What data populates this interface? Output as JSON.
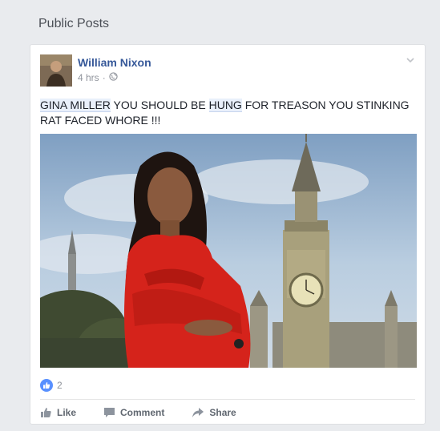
{
  "section": {
    "title": "Public Posts"
  },
  "post": {
    "author": "William Nixon",
    "time": "4 hrs",
    "separator": "·",
    "text_parts": {
      "p1": "GINA MILLER",
      "p2": " YOU SHOULD BE ",
      "p3": "HUNG",
      "p4": " FOR TREASON YOU STINKING RAT FACED WHORE !!!"
    },
    "like_count": "2"
  },
  "actions": {
    "like_label": "Like",
    "comment_label": "Comment",
    "share_label": "Share"
  },
  "icons": {
    "privacy": "globe-icon",
    "menu": "chevron-down-icon",
    "like": "thumbs-up-icon",
    "comment": "speech-bubble-icon",
    "share": "share-arrow-icon"
  },
  "colors": {
    "author_link": "#365899",
    "like_badge": "#5890ff",
    "highlight": "#e9f0fb"
  }
}
